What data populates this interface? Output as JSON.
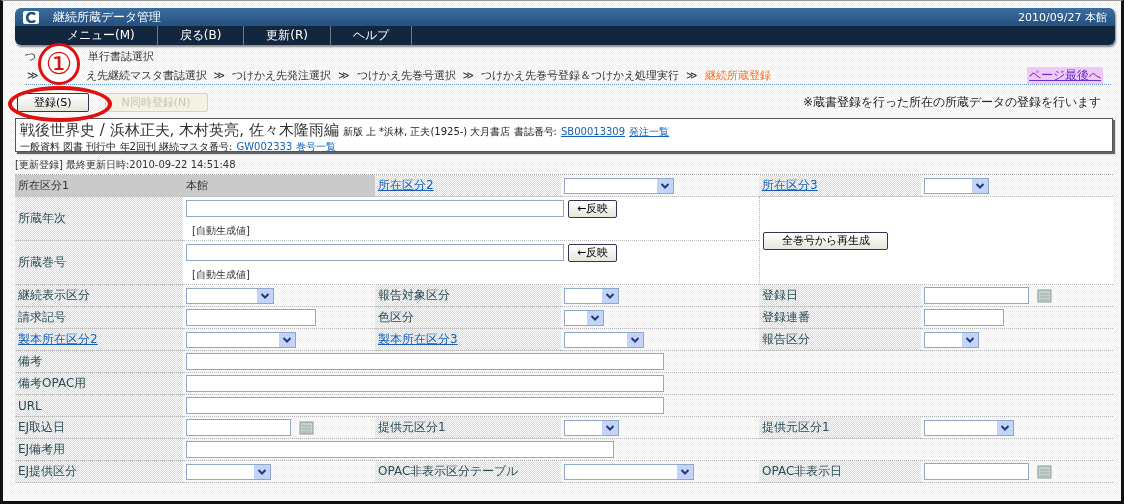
{
  "window": {
    "title": "継続所蔵データ管理",
    "date": "2010/09/27 本館"
  },
  "menu": [
    {
      "label": "メニュー(M)"
    },
    {
      "label": "戻る(B)"
    },
    {
      "label": "更新(R)"
    },
    {
      "label": "ヘルプ"
    }
  ],
  "annotation": {
    "number": "①"
  },
  "breadcrumb": {
    "first_line": [
      "つ",
      "単行書誌選択"
    ],
    "steps": [
      {
        "kind": "sep",
        "text": "≫"
      },
      {
        "kind": "step",
        "text": "え先継続マスタ書誌選択",
        "selected": false
      },
      {
        "kind": "sep",
        "text": "≫"
      },
      {
        "kind": "step",
        "text": "つけかえ先発注選択",
        "selected": false
      },
      {
        "kind": "sep",
        "text": "≫"
      },
      {
        "kind": "step",
        "text": "つけかえ先巻号選択",
        "selected": false
      },
      {
        "kind": "sep",
        "text": "≫"
      },
      {
        "kind": "step",
        "text": "つけかえ先巻号登録＆つけかえ処理実行",
        "selected": false
      },
      {
        "kind": "sep",
        "text": "≫"
      },
      {
        "kind": "step",
        "text": "継続所蔵登録",
        "selected": true
      }
    ],
    "page_end_link": "ページ最後へ"
  },
  "actions": [
    {
      "label": "登録(S)",
      "disabled": false
    },
    {
      "label": "N同時登録(N)",
      "disabled": true
    }
  ],
  "notice": "※蔵書登録を行った所在の所蔵データの登録を行います",
  "bib": {
    "title": "戦後世界史 / 浜林正夫, 木村英亮, 佐々木隆雨編",
    "details": "新版 上 *浜林, 正夫(1925-) 大月書店 書誌番号:",
    "bib_id": "SB00013309",
    "order_link": "発注一覧",
    "line2": "一般資料 図書 刊行中 年2回刊 継続マスタ番号:",
    "master_id": "GW002333",
    "volume_link": "巻号一覧"
  },
  "status": "[更新登録] 最終更新日時:2010-09-22 14:51:48",
  "form": {
    "regenerate_button": "全巻号から再生成",
    "rows": [
      {
        "kind": "fields",
        "cells": [
          {
            "kind": "fixed_label",
            "text": "所在区分1"
          },
          {
            "kind": "fixed_value",
            "text": "本館"
          },
          {
            "kind": "link",
            "text": "所在区分2"
          },
          {
            "kind": "select"
          },
          {
            "kind": "link",
            "text": "所在区分3"
          },
          {
            "kind": "select"
          }
        ]
      },
      {
        "kind": "reflect",
        "label": "所蔵年次",
        "button": "←反映",
        "note": "[自動生成値]"
      },
      {
        "kind": "reflect",
        "label": "所蔵巻号",
        "button": "←反映",
        "note": "[自動生成値]"
      },
      {
        "kind": "fields",
        "cells": [
          {
            "kind": "label",
            "text": "継続表示区分"
          },
          {
            "kind": "select"
          },
          {
            "kind": "label",
            "text": "報告対象区分"
          },
          {
            "kind": "select"
          },
          {
            "kind": "label",
            "text": "登録日"
          },
          {
            "kind": "date"
          }
        ]
      },
      {
        "kind": "fields",
        "cells": [
          {
            "kind": "label",
            "text": "請求記号"
          },
          {
            "kind": "input"
          },
          {
            "kind": "label",
            "text": "色区分"
          },
          {
            "kind": "select"
          },
          {
            "kind": "label",
            "text": "登録連番"
          },
          {
            "kind": "input"
          }
        ]
      },
      {
        "kind": "fields",
        "cells": [
          {
            "kind": "link",
            "text": "製本所在区分2"
          },
          {
            "kind": "select"
          },
          {
            "kind": "link",
            "text": "製本所在区分3"
          },
          {
            "kind": "select"
          },
          {
            "kind": "label",
            "text": "報告区分"
          },
          {
            "kind": "select"
          }
        ]
      },
      {
        "kind": "wide",
        "label": "備考"
      },
      {
        "kind": "wide",
        "label": "備考OPAC用"
      },
      {
        "kind": "wide",
        "label": "URL"
      },
      {
        "kind": "fields",
        "cells": [
          {
            "kind": "label",
            "text": "EJ取込日"
          },
          {
            "kind": "date"
          },
          {
            "kind": "label",
            "text": "提供元区分1"
          },
          {
            "kind": "select"
          },
          {
            "kind": "label",
            "text": "提供元区分1"
          },
          {
            "kind": "select"
          }
        ]
      },
      {
        "kind": "wide",
        "label": "EJ備考用"
      },
      {
        "kind": "fields",
        "cells": [
          {
            "kind": "label",
            "text": "EJ提供区分"
          },
          {
            "kind": "select"
          },
          {
            "kind": "label",
            "text": "OPAC非表示区分テーブル"
          },
          {
            "kind": "select"
          },
          {
            "kind": "label",
            "text": "OPAC非表示日"
          },
          {
            "kind": "date"
          }
        ]
      }
    ]
  }
}
